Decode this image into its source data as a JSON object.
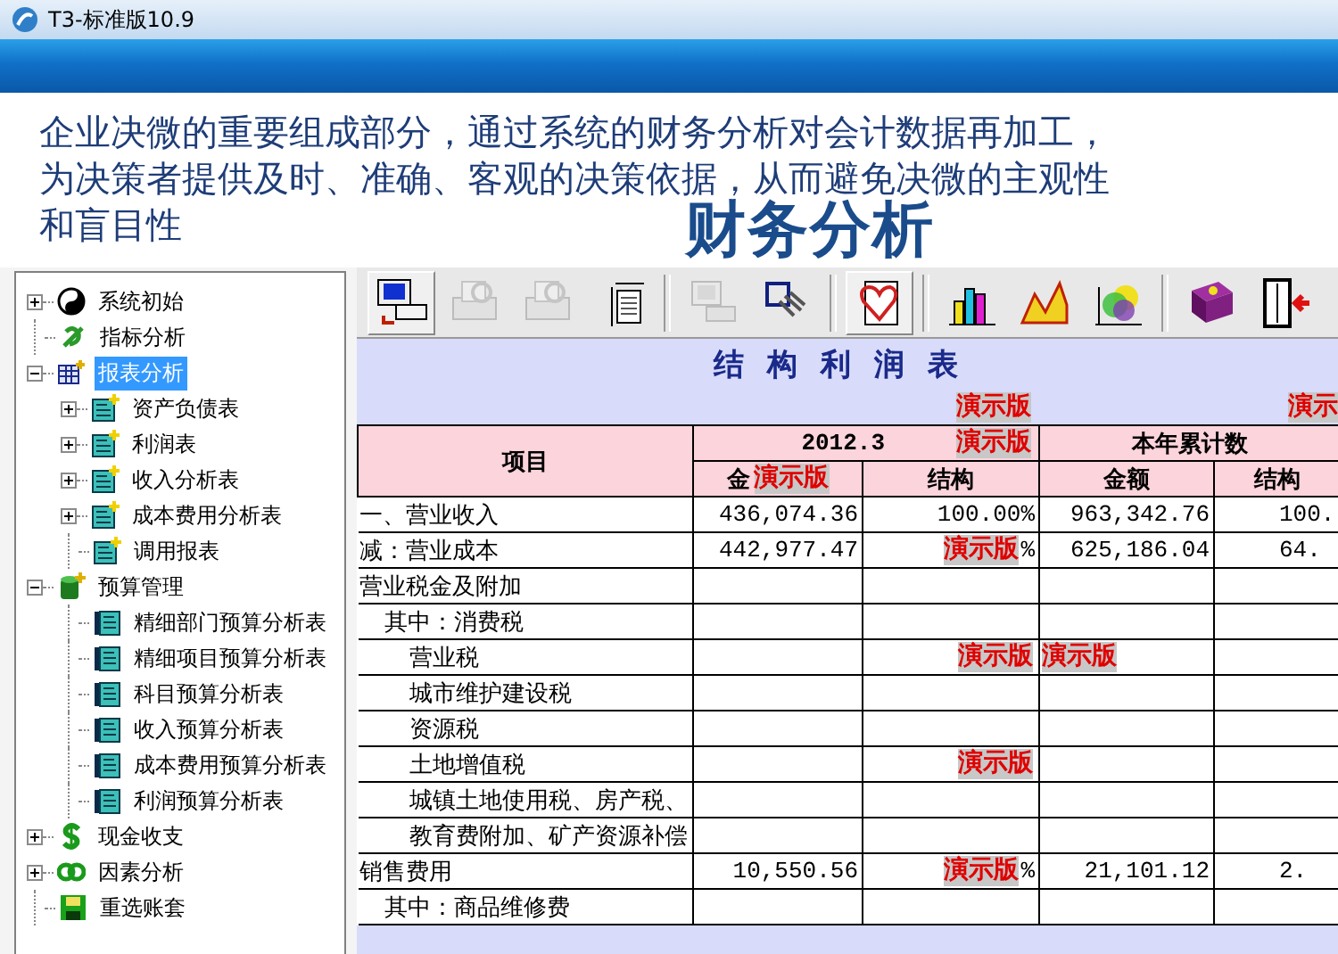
{
  "window": {
    "title": "T3-标准版10.9"
  },
  "intro": {
    "lines": [
      "企业决微的重要组成部分，通过系统的财务分析对会计数据再加工，",
      "为决策者提供及时、准确、客观的决策依据，从而避免决微的主观性",
      "和盲目性"
    ],
    "heading": "财务分析"
  },
  "tree": {
    "items": [
      {
        "label": "系统初始",
        "kind": "branch",
        "expanded": false,
        "selected": false
      },
      {
        "label": "指标分析",
        "kind": "leaf",
        "selected": false
      },
      {
        "label": "报表分析",
        "kind": "branch",
        "expanded": true,
        "selected": true,
        "children": [
          {
            "label": "资产负债表",
            "kind": "branch",
            "expanded": false,
            "selected": false
          },
          {
            "label": "利润表",
            "kind": "branch",
            "expanded": false,
            "selected": false
          },
          {
            "label": "收入分析表",
            "kind": "branch",
            "expanded": false,
            "selected": false
          },
          {
            "label": "成本费用分析表",
            "kind": "branch",
            "expanded": false,
            "selected": false
          },
          {
            "label": "调用报表",
            "kind": "leaf",
            "selected": false
          }
        ]
      },
      {
        "label": "预算管理",
        "kind": "branch",
        "expanded": true,
        "selected": false,
        "children": [
          {
            "label": "精细部门预算分析表",
            "kind": "leaf",
            "selected": false
          },
          {
            "label": "精细项目预算分析表",
            "kind": "leaf",
            "selected": false
          },
          {
            "label": "科目预算分析表",
            "kind": "leaf",
            "selected": false
          },
          {
            "label": "收入预算分析表",
            "kind": "leaf",
            "selected": false
          },
          {
            "label": "成本费用预算分析表",
            "kind": "leaf",
            "selected": false
          },
          {
            "label": "利润预算分析表",
            "kind": "leaf",
            "selected": false
          }
        ]
      },
      {
        "label": "现金收支",
        "kind": "branch",
        "expanded": false,
        "selected": false
      },
      {
        "label": "因素分析",
        "kind": "branch",
        "expanded": false,
        "selected": false
      },
      {
        "label": "重选账套",
        "kind": "leaf",
        "selected": false
      }
    ]
  },
  "toolbar": {
    "groups": [
      [
        {
          "disabled": false,
          "pressed": true
        },
        {
          "disabled": true,
          "pressed": false
        },
        {
          "disabled": true,
          "pressed": false
        },
        {
          "disabled": false,
          "pressed": false
        }
      ],
      [
        {
          "disabled": true,
          "pressed": false
        },
        {
          "disabled": false,
          "pressed": false
        }
      ],
      [
        {
          "disabled": false,
          "pressed": true
        }
      ],
      [
        {
          "disabled": false,
          "pressed": false
        },
        {
          "disabled": false,
          "pressed": false
        },
        {
          "disabled": false,
          "pressed": false
        }
      ],
      [
        {
          "disabled": false,
          "pressed": false
        },
        {
          "disabled": false,
          "pressed": false
        }
      ]
    ]
  },
  "report": {
    "title": "结构利润表",
    "title_marks": {
      "structure": "演示版",
      "ytd_structure": "演示"
    },
    "header": {
      "item": "项目",
      "period": "2012.3",
      "period_demo": "演示版",
      "ytd": "本年累计数",
      "sub": [
        {
          "label": "金",
          "demo": "演示版"
        },
        {
          "label": "结构"
        },
        {
          "label": "金额"
        },
        {
          "label": "结构"
        }
      ]
    },
    "rows": [
      {
        "item": "一、营业收入",
        "amount": "436,074.36",
        "structure": "100.00%",
        "ytd_amount": "963,342.76",
        "ytd_structure": "100."
      },
      {
        "item": "减：营业成本",
        "amount": "442,977.47",
        "structure": "%",
        "ytd_amount": "625,186.04",
        "ytd_structure": "64.",
        "marks": {
          "structure": "演示版"
        }
      },
      {
        "item": "营业税金及附加",
        "children": [
          {
            "item": "其中：消费税",
            "children": [
              {
                "item": "营业税",
                "marks": {
                  "structure": "演示版",
                  "ytd_amount": "演示版"
                }
              },
              {
                "item": "城市维护建设税"
              },
              {
                "item": "资源税"
              },
              {
                "item": "土地增值税",
                "marks": {
                  "structure": "演示版"
                }
              },
              {
                "item": "城镇土地使用税、房产税、"
              },
              {
                "item": "教育费附加、矿产资源补偿"
              }
            ]
          }
        ]
      },
      {
        "item": "销售费用",
        "amount": "10,550.56",
        "structure": "%",
        "ytd_amount": "21,101.12",
        "ytd_structure": "2.",
        "marks": {
          "structure": "演示版"
        },
        "children": [
          {
            "item": "其中：商品维修费"
          }
        ]
      }
    ]
  }
}
